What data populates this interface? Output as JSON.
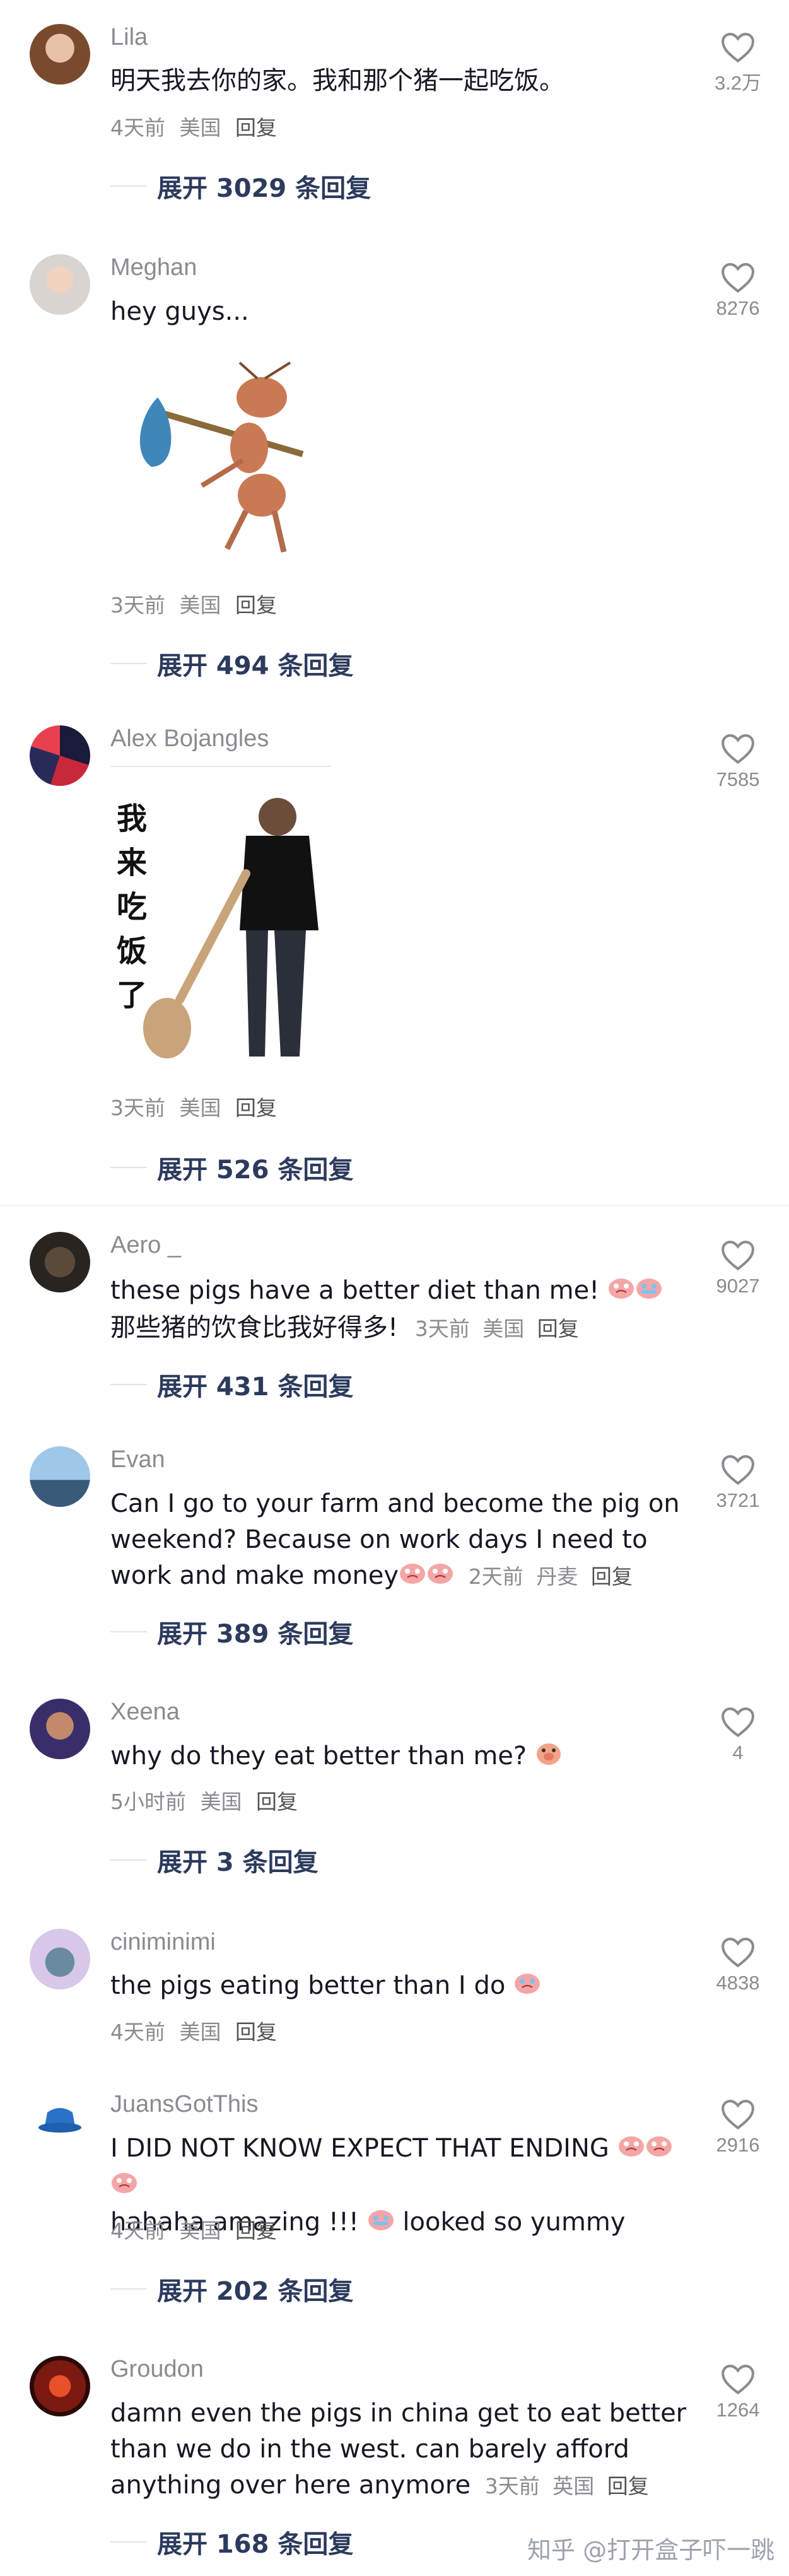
{
  "comments": [
    {
      "user": "Lila",
      "text": "明天我去你的家。我和那个猪一起吃饭。",
      "time": "4天前",
      "region": "美国",
      "reply": "回复",
      "likes": "3.2万",
      "expand": "展开 3029 条回复"
    },
    {
      "user": "Meghan",
      "text": "hey guys...",
      "time": "3天前",
      "region": "美国",
      "reply": "回复",
      "likes": "8276",
      "expand": "展开 494 条回复"
    },
    {
      "user": "Alex Bojangles",
      "sticker_text": "我来吃饭了",
      "time": "3天前",
      "region": "美国",
      "reply": "回复",
      "likes": "7585",
      "expand": "展开 526 条回复"
    },
    {
      "user": "Aero _",
      "text": "these pigs have a better diet than me!",
      "text2": "那些猪的饮食比我好得多!",
      "time": "3天前",
      "region": "美国",
      "reply": "回复",
      "likes": "9027",
      "expand": "展开 431 条回复"
    },
    {
      "user": "Evan",
      "text": "Can I go to your farm and become the pig on weekend? Because on work days I need to work and make money",
      "time": "2天前",
      "region": "丹麦",
      "reply": "回复",
      "likes": "3721",
      "expand": "展开 389 条回复"
    },
    {
      "user": "Xeena",
      "text": "why do they eat better than me?",
      "time": "5小时前",
      "region": "美国",
      "reply": "回复",
      "likes": "4",
      "expand": "展开 3 条回复"
    },
    {
      "user": "ciniminimi",
      "text": "the pigs eating better than I do",
      "time": "4天前",
      "region": "美国",
      "reply": "回复",
      "likes": "4838"
    },
    {
      "user": "JuansGotThis",
      "text": "I DID NOT KNOW EXPECT THAT ENDING",
      "text2a": "hahaha amazing !!!",
      "text2b": "looked so yummy",
      "time": "4天前",
      "region": "美国",
      "reply": "回复",
      "likes": "2916",
      "expand": "展开 202 条回复"
    },
    {
      "user": "Groudon",
      "text": "damn even the pigs in china get to eat better than we do in the west. can barely afford anything over here anymore",
      "time": "3天前",
      "region": "英国",
      "reply": "回复",
      "likes": "1264",
      "expand": "展开 168 条回复"
    }
  ],
  "watermark": "知乎 @打开盒子吓一跳",
  "colors": {
    "text": "#161823",
    "meta": "#8a8b91",
    "expand": "#2c3a5d",
    "like_icon": "#8a8b91"
  },
  "icons": {
    "like": "heart-outline-icon",
    "emoji": "crying-face-emoji"
  }
}
